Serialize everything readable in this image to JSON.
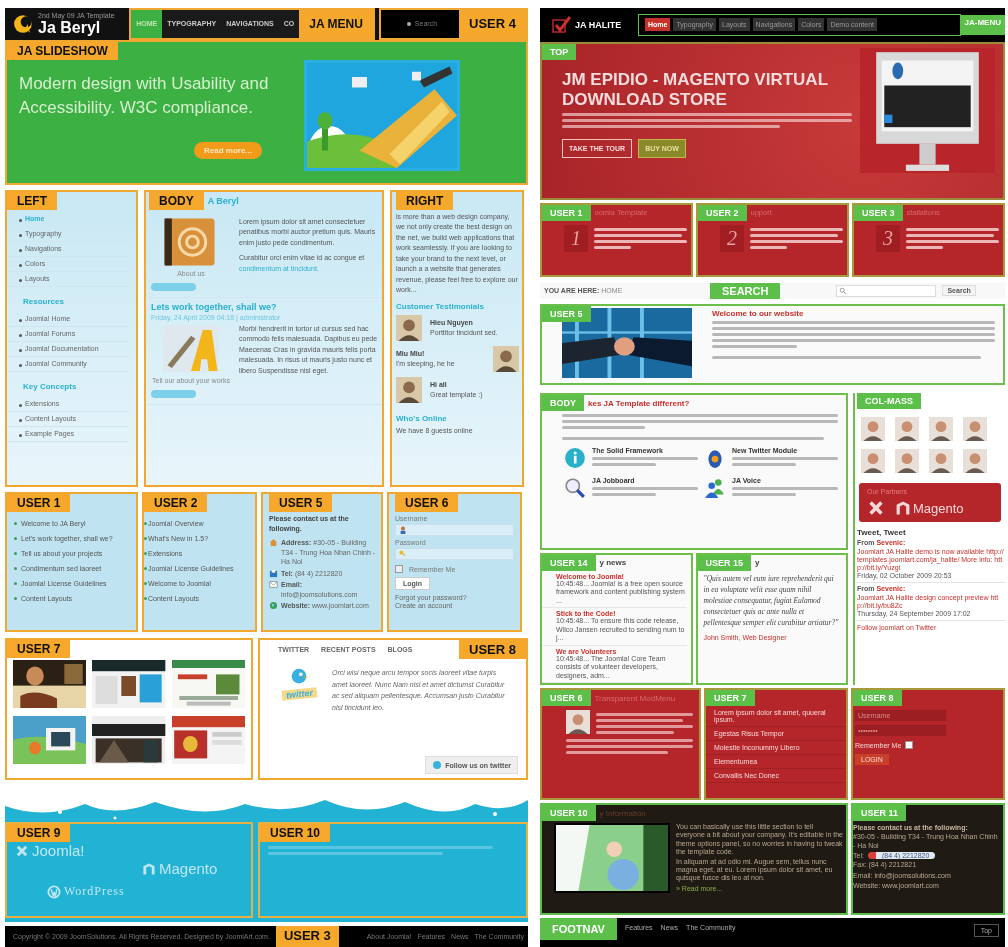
{
  "beryl": {
    "header": {
      "logo": "Ja Beryl",
      "tagline": "2nd May 09 JA Template",
      "menu": [
        {
          "label": "HOME",
          "selected": true
        },
        {
          "label": "TYPOGRAPHY",
          "selected": false
        },
        {
          "label": "NAVIGATIONS",
          "selected": false
        },
        {
          "label": "CO",
          "selected": false
        }
      ],
      "menu_tag": "JA MENU",
      "search": {
        "placeholder": "Search"
      },
      "search_tag": "USER 4"
    },
    "slideshow": {
      "tag": "JA SLIDESHOW",
      "headline": "Modern design with Usability and Accessibility. W3C compliance.",
      "button": "Read more..."
    },
    "left": {
      "tag": "LEFT",
      "groups": [
        {
          "items": [
            {
              "label": "Home",
              "selected": true
            },
            {
              "label": "Typography",
              "selected": false
            },
            {
              "label": "Navigations",
              "selected": false
            },
            {
              "label": "Colors",
              "selected": false
            },
            {
              "label": "Layouts",
              "selected": false
            }
          ]
        },
        {
          "title": "Resources",
          "items": [
            {
              "label": "Joomla! Home",
              "selected": false
            },
            {
              "label": "Joomla! Forums",
              "selected": false
            },
            {
              "label": "Joomla! Documentation",
              "selected": false
            },
            {
              "label": "Joomla! Community",
              "selected": false
            }
          ]
        },
        {
          "title": "Key Concepts",
          "items": [
            {
              "label": "Extensions",
              "selected": false
            },
            {
              "label": "Content Layouts",
              "selected": false
            },
            {
              "label": "Example Pages",
              "selected": false
            }
          ]
        }
      ]
    },
    "body": {
      "tag": "BODY",
      "articles": [
        {
          "title": "A Beryl",
          "paragraphs": [
            "Lorem ipsum dolor sit amet consectetuer penatibus morbi auctor pretium quis. Mauris enim justo pede condimentum.",
            "Curabitur orci enim vitae id ac congue et"
          ],
          "link": "condimentum at tincidunt.",
          "caption": "About us"
        },
        {
          "title": "Lets work together, shall we?",
          "meta": "Friday, 24 April 2009 04:18 | administrator",
          "paragraphs": [
            "Morbi hendrerit in tortor ut cursus sed hac commodo felis malesuada. Dapibus eu pede Maecenas Cras in gravida mauris felis porta malesuada. In risus ut mauris justo nunc et libero Suspendisse nisl eget."
          ],
          "caption": "Tell our about your works"
        }
      ]
    },
    "right": {
      "tag": "RIGHT",
      "intro": "is more than a web design company, we not only create the best design on the net, we build web applications that work seamlessly. If you are looking to take your brand to the next level, or launch a a website that generates revenue, please feel free to explore our work...",
      "heading": "Customer Testimonials",
      "testimonials": [
        {
          "name": "Hieu Nguyen",
          "text": "Porttitor tincidunt sed."
        },
        {
          "name": "Miu Miu!",
          "text": "I'm sleeping, he he"
        },
        {
          "name": "Hi all",
          "text": "Great template :)"
        }
      ],
      "online_title": "Who's Online",
      "online_text": "We have 8 guests online"
    },
    "user1": {
      "tag": "USER 1",
      "items": [
        "Welcome to JA Beryl",
        "Let's work together, shall we?",
        "Tell us about your projects",
        "Condimentum sed laoreet",
        "Joomla! License Guidelines",
        "Content Layouts"
      ]
    },
    "user2": {
      "tag": "USER 2",
      "items": [
        "Joomla! Overview",
        "What's New in 1.5?",
        "Extensions",
        "Joomla! License Guidelines",
        "Welcome to Joomla!",
        "Content Layouts"
      ]
    },
    "user5": {
      "tag": "USER 5",
      "intro": "Please contact us at the following.",
      "rows": [
        {
          "kind": "address",
          "label": "Address:",
          "value": "#30-05 - Building T34 - Trung Hoa Nhan Chinh - Ha Noi"
        },
        {
          "kind": "phone",
          "label": "Tel:",
          "value": "(84 4) 2212820"
        },
        {
          "kind": "email",
          "label": "Email:",
          "value": "info@joomsolutions.com"
        },
        {
          "kind": "web",
          "label": "Website:",
          "value": "www.joomlart.com"
        }
      ]
    },
    "user6": {
      "tag": "USER 6",
      "username_label": "Username",
      "password_label": "Password",
      "remember": {
        "label": "Remember Me",
        "checked": false
      },
      "login": "Login",
      "links": [
        "Forgot your password?",
        "Create an account"
      ]
    },
    "user7": {
      "tag": "USER 7"
    },
    "user8": {
      "tag": "USER 8",
      "tabs": [
        "TWITTER",
        "RECENT POSTS",
        "BLOGS"
      ],
      "badge": "twitter",
      "quote": "Orci wisi neque arcu tempor socis laoreet vitae turpis amet laoreet. Nunc Nam nisl et amet dictumst Curabitur ac sed aliquam pellentesque. Accumsan justo Curabitur nisl tincidunt leo.",
      "follow": "Follow us on twitter"
    },
    "user9": {
      "tag": "USER 9",
      "logos": [
        "Joomla!",
        "Magento",
        "WordPress"
      ]
    },
    "user10": {
      "tag": "USER 10"
    },
    "footer": {
      "copyright": "Copyright © 2009 JoomSolutions. All Rights Reserved. Designed by JoomlArt.com.",
      "tag": "USER 3",
      "links": [
        "About Joomla!",
        "Features",
        "News",
        "The Community"
      ]
    }
  },
  "halite": {
    "header": {
      "logo": "JA HALITE",
      "menu": [
        {
          "label": "Home",
          "selected": true
        },
        {
          "label": "Typography",
          "selected": false
        },
        {
          "label": "Layouts",
          "selected": false
        },
        {
          "label": "Navigations",
          "selected": false
        },
        {
          "label": "Colors",
          "selected": false
        },
        {
          "label": "Demo content",
          "selected": false
        }
      ],
      "menu_tag": "JA-MENU"
    },
    "top": {
      "tag": "TOP",
      "headline": "JM EPIDIO - MAGENTO VIRTUAL DOWNLOAD STORE",
      "buttons": [
        {
          "label": "TAKE THE TOUR",
          "kind": "outline"
        },
        {
          "label": "BUY NOW",
          "kind": "solid"
        }
      ]
    },
    "features": [
      {
        "tag": "USER 1",
        "title": "oomla Template",
        "number": "1"
      },
      {
        "tag": "USER 2",
        "title": "upport",
        "number": "2"
      },
      {
        "tag": "USER 3",
        "title": "stallations",
        "number": "3"
      }
    ],
    "breadcrumb": {
      "label": "YOU ARE HERE:",
      "page": "HOME",
      "search_tag": "SEARCH",
      "search_button": "Search"
    },
    "user5": {
      "tag": "USER 5",
      "title": "Welcome to our website"
    },
    "body": {
      "tag": "BODY",
      "title": "kes JA Template different?",
      "items": [
        {
          "kind": "info",
          "title": "The Solid Framework"
        },
        {
          "kind": "bird",
          "title": "New Twitter Module"
        },
        {
          "kind": "search",
          "title": "JA Jobboard"
        },
        {
          "kind": "people",
          "title": "JA Voice"
        }
      ]
    },
    "colmass": {
      "tag": "COL-MASS",
      "partners_title": "Our Partners",
      "partner": "Magento",
      "tweet_title": "Tweet, Tweet",
      "tweets": [
        {
          "from": "From",
          "user": "Sevenic:",
          "text": "Joomlart JA Halite demo is now available http://templates.joomlart.com/ja_halite/ More info: http://bit.ly/Yuzgi",
          "date": "Friday, 02 October 2009 20:53"
        },
        {
          "from": "From",
          "user": "Sevenic:",
          "text": "Joomlart JA Halite design concept preview http://bit.ly/bu8Zc",
          "date": "Thursday, 24 September 2009 17:02"
        }
      ],
      "follow": "Follow joomlart on Twitter"
    },
    "user14": {
      "tag": "USER 14",
      "title": "y news",
      "items": [
        {
          "title": "Welcome to Joomla!",
          "text": "10:45:48... Joomla! is a free open source framework and content publishing system ..."
        },
        {
          "title": "Stick to the Code!",
          "text": "10:45:48... To ensure this code release, Wilco Jansen recruited to sending num to j..."
        },
        {
          "title": "We are Volunteers",
          "text": "10:45:48... The Joomla! Core Team consists of volunteer developers, designers, adm..."
        }
      ]
    },
    "user15": {
      "tag": "USER 15",
      "title": "y",
      "quote": "\"Quis autem vel eum iure reprehenderit qui in ea voluptate velit esse quam nihil molestiae consequatur, fugiat Eulamod consectetuer quis ac ante nulla et pellentesque semper elit curabitur artiatur?\"",
      "author": "John Smith, Web Designer"
    },
    "user6": {
      "tag": "USER 6",
      "title": "Transparent ModMenu"
    },
    "user7": {
      "tag": "USER 7",
      "items": [
        "Lorem ipsum dolor sit amet, quueral ipsum.",
        "Egestas Risus Tempor",
        "Molestie Inconummy Libero",
        "Elementumea",
        "Convallis Nec Donec"
      ]
    },
    "user8": {
      "tag": "USER 8",
      "username": {
        "placeholder": "Username"
      },
      "password": {
        "value": "••••••••"
      },
      "remember": {
        "label": "Remember Me",
        "checked": false
      },
      "login": "LOGIN"
    },
    "user10": {
      "tag": "USER 10",
      "title": "y Information",
      "paragraphs": [
        "You can basically use this little section to tell everyone a bit about your company. It's editable in the theme options panel, so no worries in having to tweak the template code.",
        "In aliquam at ad odio mi. Augue sem, tellus nunc magna eget, at eu. Lorem ipsum dolor sit amet, eu quisque fusce dis leo at non."
      ],
      "more": "» Read more..."
    },
    "user11": {
      "tag": "USER 11",
      "intro": "Please contact us at the following:",
      "address": "#30-05 - Building T34 - Trung Hoa Nhan Chinh - Ha Noi",
      "tel_label": "Tel:",
      "tel": "(84 4) 2212820",
      "lines": [
        "Fax: (84 4) 2212821",
        "Email: info@joomsolutions.com",
        "Website: www.joomlart.com"
      ]
    },
    "footnav": {
      "tag": "FOOTNAV",
      "links": [
        "Features",
        "News",
        "The Community"
      ],
      "top": "Top"
    }
  }
}
